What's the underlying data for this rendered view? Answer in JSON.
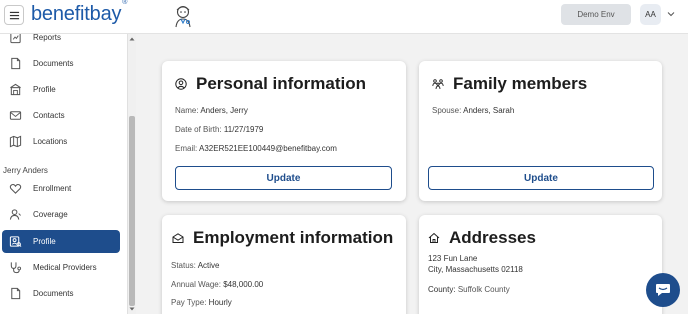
{
  "header": {
    "logo_text": "benefitbay",
    "logo_mark": "®",
    "env_button": "Demo Env",
    "avatar_initials": "AA"
  },
  "sidebar": {
    "items_top": [
      {
        "label": "Reports",
        "icon": "reports-icon"
      },
      {
        "label": "Documents",
        "icon": "document-icon"
      },
      {
        "label": "Profile",
        "icon": "building-icon"
      },
      {
        "label": "Contacts",
        "icon": "mail-icon"
      },
      {
        "label": "Locations",
        "icon": "map-icon"
      }
    ],
    "section_label": "Jerry Anders",
    "items_member": [
      {
        "label": "Enrollment",
        "icon": "heart-icon"
      },
      {
        "label": "Coverage",
        "icon": "person-icon"
      },
      {
        "label": "Profile",
        "icon": "profile-icon",
        "active": true
      },
      {
        "label": "Medical Providers",
        "icon": "stethoscope-icon"
      },
      {
        "label": "Documents",
        "icon": "document-icon"
      }
    ]
  },
  "personal": {
    "title": "Personal information",
    "name_label": "Name:",
    "name_value": "Anders, Jerry",
    "dob_label": "Date of Birth:",
    "dob_value": "11/27/1979",
    "email_label": "Email:",
    "email_value": "A32ER521EE100449@benefitbay.com",
    "update_label": "Update"
  },
  "family": {
    "title": "Family members",
    "spouse_label": "Spouse:",
    "spouse_value": "Anders, Sarah",
    "update_label": "Update"
  },
  "employment": {
    "title": "Employment information",
    "status_label": "Status:",
    "status_value": "Active",
    "wage_label": "Annual Wage:",
    "wage_value": "$48,000.00",
    "paytype_label": "Pay Type:",
    "paytype_value": "Hourly"
  },
  "addresses": {
    "title": "Addresses",
    "line1": "123 Fun Lane",
    "line2": "City, Massachusetts 02118",
    "county_label": "County:",
    "county_value": "Suffolk County"
  },
  "colors": {
    "brand": "#1d5aa8",
    "accent": "#1e4d8c"
  }
}
